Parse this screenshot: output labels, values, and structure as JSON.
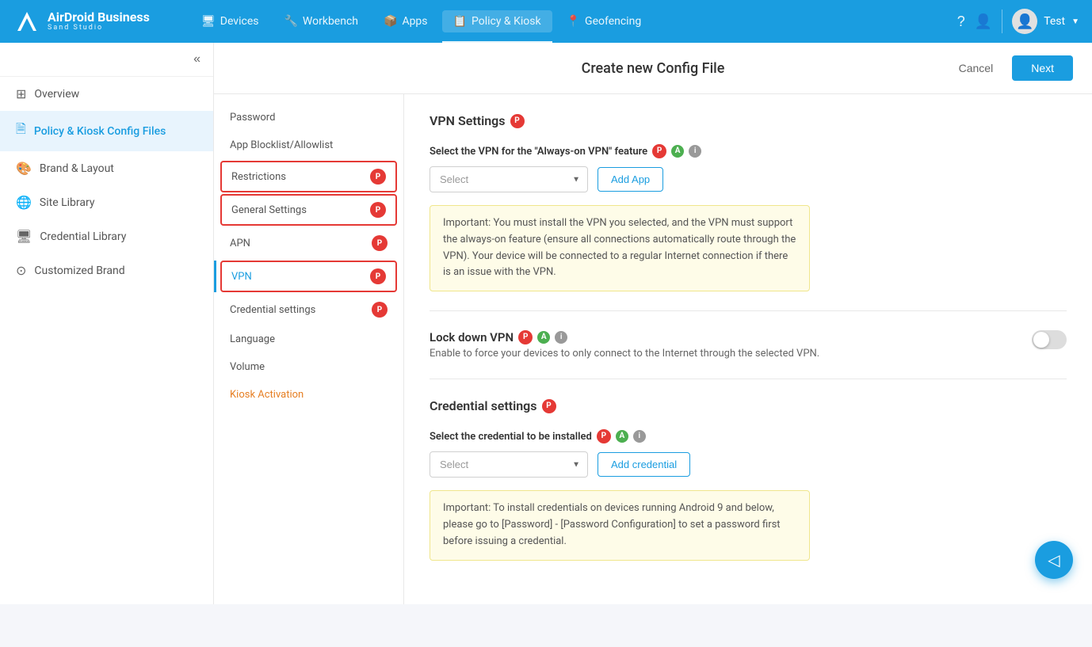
{
  "app": {
    "name": "AirDroid Business",
    "subtitle": "Sand Studio"
  },
  "nav": {
    "items": [
      {
        "id": "devices",
        "label": "Devices",
        "icon": "🖥",
        "active": false
      },
      {
        "id": "workbench",
        "label": "Workbench",
        "icon": "🔧",
        "active": false
      },
      {
        "id": "apps",
        "label": "Apps",
        "icon": "📦",
        "active": false
      },
      {
        "id": "policy-kiosk",
        "label": "Policy & Kiosk",
        "icon": "📋",
        "active": true
      },
      {
        "id": "geofencing",
        "label": "Geofencing",
        "icon": "📍",
        "active": false
      }
    ],
    "user": "Test"
  },
  "sidebar": {
    "items": [
      {
        "id": "overview",
        "label": "Overview",
        "icon": "grid",
        "active": false
      },
      {
        "id": "policy-kiosk-config",
        "label": "Policy & Kiosk Config Files",
        "icon": "file",
        "active": true
      },
      {
        "id": "brand-layout",
        "label": "Brand & Layout",
        "icon": "paint",
        "active": false
      },
      {
        "id": "site-library",
        "label": "Site Library",
        "icon": "globe",
        "active": false
      },
      {
        "id": "credential-library",
        "label": "Credential Library",
        "icon": "monitor",
        "active": false
      },
      {
        "id": "customized-brand",
        "label": "Customized Brand",
        "icon": "star",
        "active": false
      }
    ]
  },
  "page": {
    "title": "Create new Config File",
    "cancel_label": "Cancel",
    "next_label": "Next"
  },
  "config_menu": {
    "items": [
      {
        "id": "password",
        "label": "Password",
        "badge": false,
        "color": null,
        "active": false
      },
      {
        "id": "app-blocklist",
        "label": "App Blocklist/Allowlist",
        "badge": false,
        "color": null,
        "active": false
      },
      {
        "id": "restrictions",
        "label": "Restrictions",
        "badge": true,
        "badge_color": "red",
        "active": false,
        "selected": true
      },
      {
        "id": "general-settings",
        "label": "General Settings",
        "badge": true,
        "badge_color": "red",
        "active": false,
        "selected": true
      },
      {
        "id": "apn",
        "label": "APN",
        "badge": true,
        "badge_color": "red",
        "active": false
      },
      {
        "id": "vpn",
        "label": "VPN",
        "badge": true,
        "badge_color": "red",
        "active": true,
        "selected": true
      },
      {
        "id": "credential-settings",
        "label": "Credential settings",
        "badge": true,
        "badge_color": "red",
        "active": false
      },
      {
        "id": "language",
        "label": "Language",
        "badge": false,
        "active": false
      },
      {
        "id": "volume",
        "label": "Volume",
        "badge": false,
        "active": false
      },
      {
        "id": "kiosk-activation",
        "label": "Kiosk Activation",
        "badge": false,
        "active": false,
        "color": "orange"
      }
    ]
  },
  "vpn_settings": {
    "section_title": "VPN Settings",
    "vpn_select_label": "Select the VPN for the \"Always-on VPN\" feature",
    "vpn_select_placeholder": "Select",
    "vpn_add_btn": "Add App",
    "vpn_info": "Important: You must install the VPN you selected, and the VPN must support the always-on feature (ensure all connections automatically route through the VPN). Your device will be connected to a regular Internet connection if there is an issue with the VPN.",
    "lockdown_label": "Lock down VPN",
    "lockdown_desc": "Enable to force your devices to only connect to the Internet through the selected VPN."
  },
  "credential_settings": {
    "section_title": "Credential settings",
    "credential_select_label": "Select the credential to be installed",
    "credential_select_placeholder": "Select",
    "credential_add_btn": "Add credential",
    "credential_info": "Important: To install credentials on devices running Android 9 and below, please go to [Password] - [Password Configuration] to set a password first before issuing a credential."
  }
}
